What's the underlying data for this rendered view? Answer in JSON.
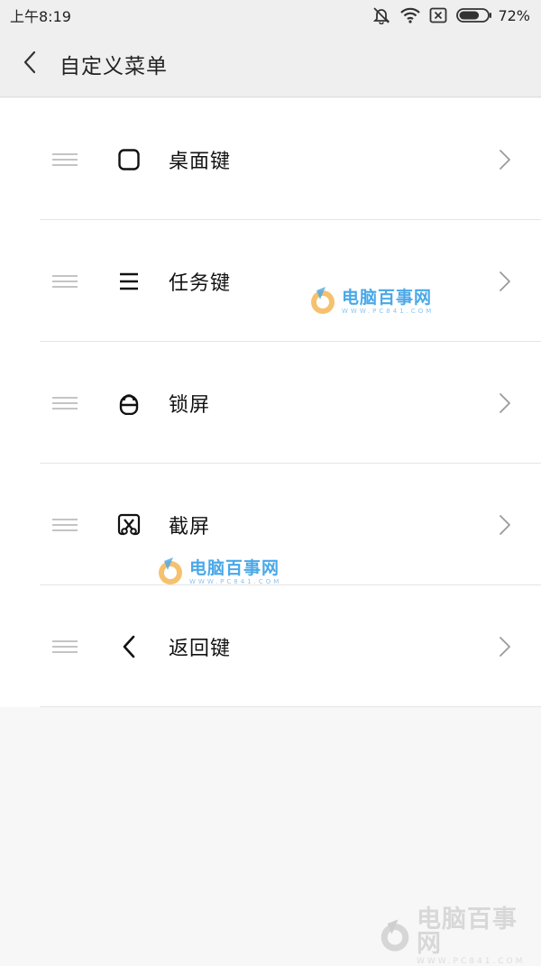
{
  "status_bar": {
    "time": "上午8:19",
    "battery_percent": "72%",
    "battery_level": 0.72
  },
  "header": {
    "title": "自定义菜单"
  },
  "menu": {
    "items": [
      {
        "label": "桌面键",
        "icon": "square-icon"
      },
      {
        "label": "任务键",
        "icon": "menu-lines-icon"
      },
      {
        "label": "锁屏",
        "icon": "lock-icon"
      },
      {
        "label": "截屏",
        "icon": "screenshot-scissors-icon"
      },
      {
        "label": "返回键",
        "icon": "back-chevron-icon"
      }
    ]
  },
  "watermark": {
    "main": "电脑百事网",
    "sub": "WWW.PC841.COM"
  }
}
